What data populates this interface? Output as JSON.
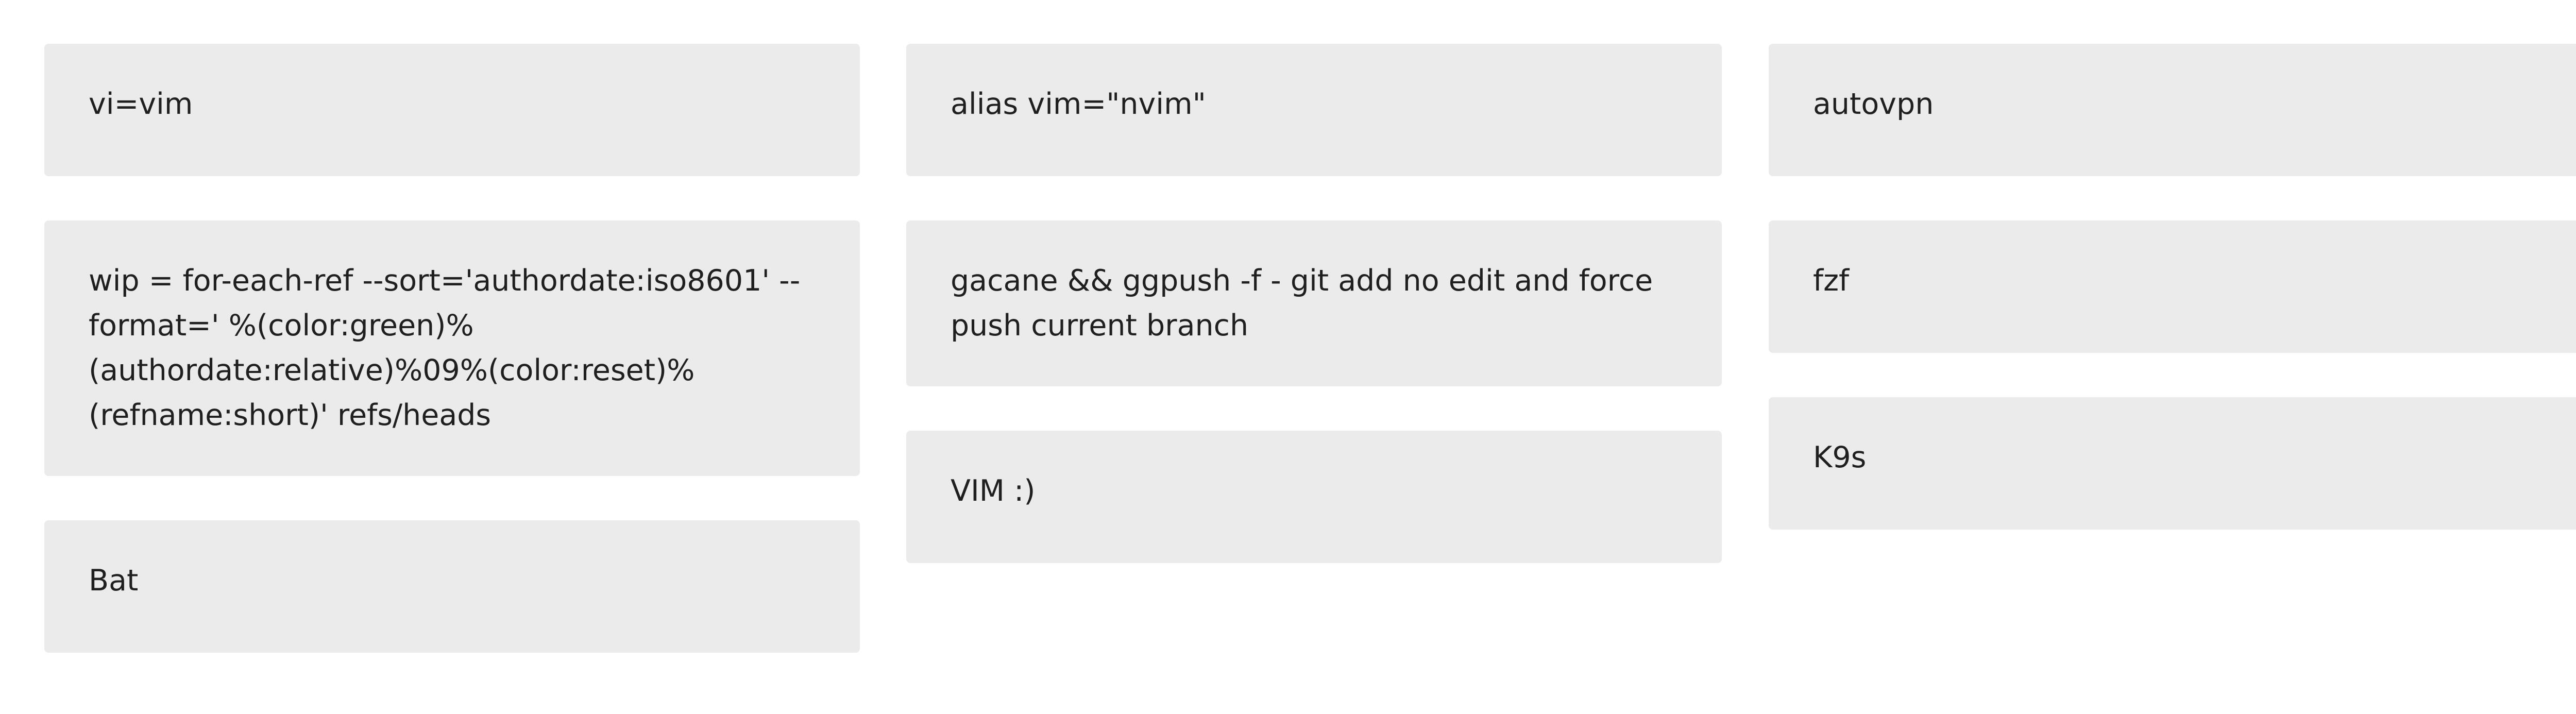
{
  "columns": [
    {
      "cards": [
        {
          "text": "vi=vim"
        },
        {
          "text": "wip = for-each-ref --sort='authordate:iso8601' --format=' %(color:green)%(authordate:relative)%09%(color:reset)%(refname:short)' refs/heads"
        },
        {
          "text": "Bat"
        }
      ]
    },
    {
      "cards": [
        {
          "text": "alias vim=\"nvim\""
        },
        {
          "text": "gacane && ggpush -f - git add no edit and force push current branch"
        },
        {
          "text": "VIM :)"
        }
      ]
    },
    {
      "cards": [
        {
          "text": "autovpn"
        },
        {
          "text": "fzf"
        },
        {
          "text": "K9s"
        }
      ]
    }
  ]
}
